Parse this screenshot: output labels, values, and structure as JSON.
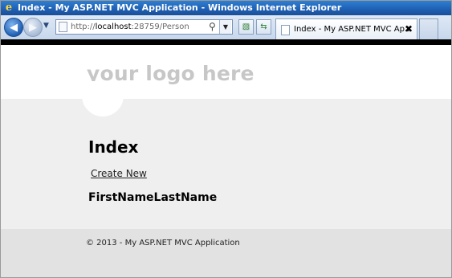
{
  "window": {
    "title": "Index - My ASP.NET MVC Application - Windows Internet Explorer"
  },
  "address_bar": {
    "url_prefix": "http://",
    "url_host": "localhost",
    "url_rest": ":28759/Person"
  },
  "tab": {
    "title": "Index - My ASP.NET MVC Ap...",
    "close_glyph": "✖"
  },
  "site": {
    "logo_text": "your logo here",
    "page_title": "Index",
    "create_new_link": "Create New",
    "table_headers": [
      "FirstName",
      "LastName"
    ],
    "footer_text": "© 2013 - My ASP.NET MVC Application"
  },
  "colors": {
    "title_bar": "#1f5fb3",
    "header_bg": "#ffffff",
    "main_bg": "#efefef",
    "footer_bg": "#e2e2e2",
    "logo_text": "#c7c7c7"
  },
  "icons": {
    "browser_logo": "internet-explorer-icon",
    "back": "back-arrow-icon",
    "forward": "forward-arrow-icon",
    "search": "magnifier-icon",
    "compatibility": "compatibility-view-icon",
    "refresh": "refresh-icon",
    "page": "page-icon"
  }
}
